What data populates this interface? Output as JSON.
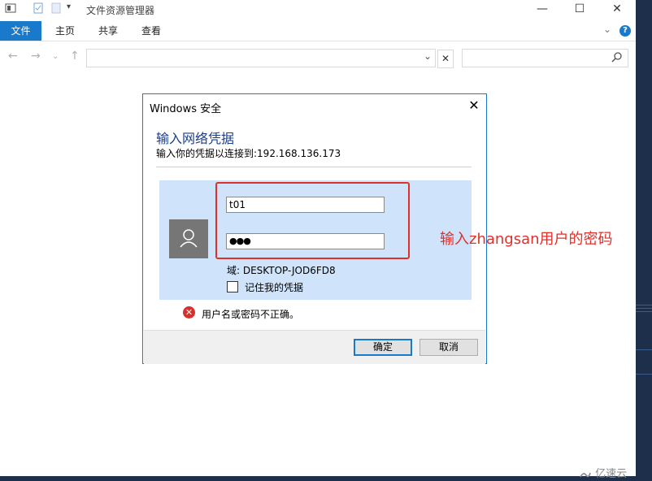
{
  "window": {
    "title": "文件资源管理器"
  },
  "ribbon": {
    "tabs": [
      "文件",
      "主页",
      "共享",
      "查看"
    ]
  },
  "dialog": {
    "title": "Windows 安全",
    "heading": "输入网络凭据",
    "subtitle": "输入你的凭据以连接到:192.168.136.173",
    "username_value": "t01",
    "password_value": "●●●",
    "domain_label": "域: DESKTOP-JOD6FD8",
    "remember_label": "记住我的凭据",
    "error_text": "用户名或密码不正确。",
    "ok_label": "确定",
    "cancel_label": "取消"
  },
  "annotation": {
    "text": "输入zhangsan用户的密码"
  },
  "watermark": {
    "text": "亿速云"
  },
  "colors": {
    "accent": "#1979ca",
    "annotation": "#e0302a",
    "panel": "#cfe4fa"
  }
}
